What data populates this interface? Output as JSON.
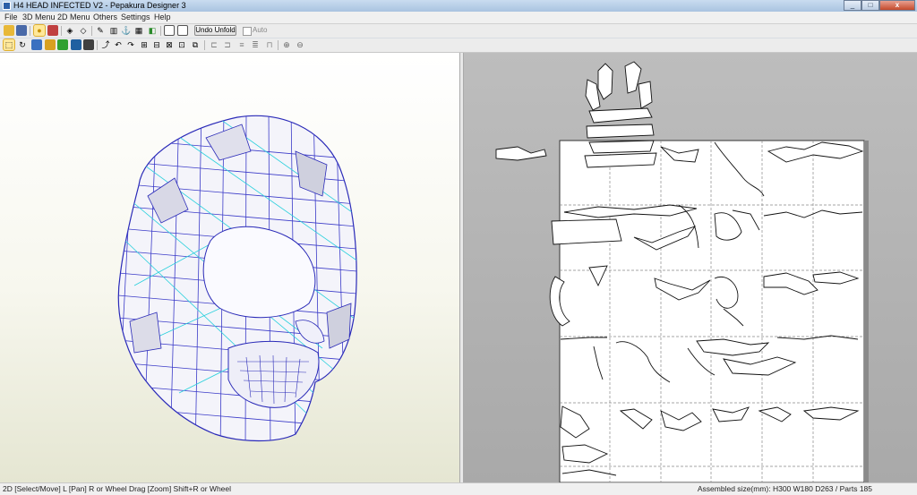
{
  "window": {
    "title": "H4 HEAD INFECTED V2 - Pepakura Designer 3",
    "buttons": [
      "minimize",
      "maximize",
      "close"
    ]
  },
  "menu": [
    "File",
    "3D Menu",
    "2D Menu",
    "Others",
    "Settings",
    "Help"
  ],
  "toolbar": {
    "undo_unfold_label": "Undo Unfold",
    "auto_label": "Auto",
    "auto_checked": false,
    "row1_icons": [
      "open-icon",
      "save-icon",
      "lightbulb-icon",
      "cube-icon",
      "fold-icon",
      "unfold-icon",
      "pencil-icon",
      "cylinder-icon",
      "anchor-icon",
      "texture-icon",
      "flip-icon",
      "edit-icon",
      "window-icon",
      "window-split-icon"
    ],
    "row2_icons": [
      "select-icon",
      "rotate-icon",
      "image-icon",
      "parts-icon",
      "joint-icon",
      "color-icon",
      "move-icon",
      "rotate-part-icon",
      "undo-icon",
      "zoom-icon",
      "flap-icon",
      "join-icon",
      "align-left-icon",
      "align-center-icon",
      "align-right-icon",
      "text-icon",
      "zoom-in-icon",
      "zoom-out-icon"
    ]
  },
  "view3d": {
    "subject": "skull head mesh",
    "edge_color": "#3030c0",
    "fold_color": "#20d0d8"
  },
  "view2d": {
    "paper_color": "#ffffff",
    "background": "#b4b4b4"
  },
  "status": {
    "left": "2D [Select/Move] L [Pan] R or Wheel Drag [Zoom] Shift+R or Wheel",
    "right": "Assembled size(mm): H300 W180 D263 / Parts 185"
  }
}
